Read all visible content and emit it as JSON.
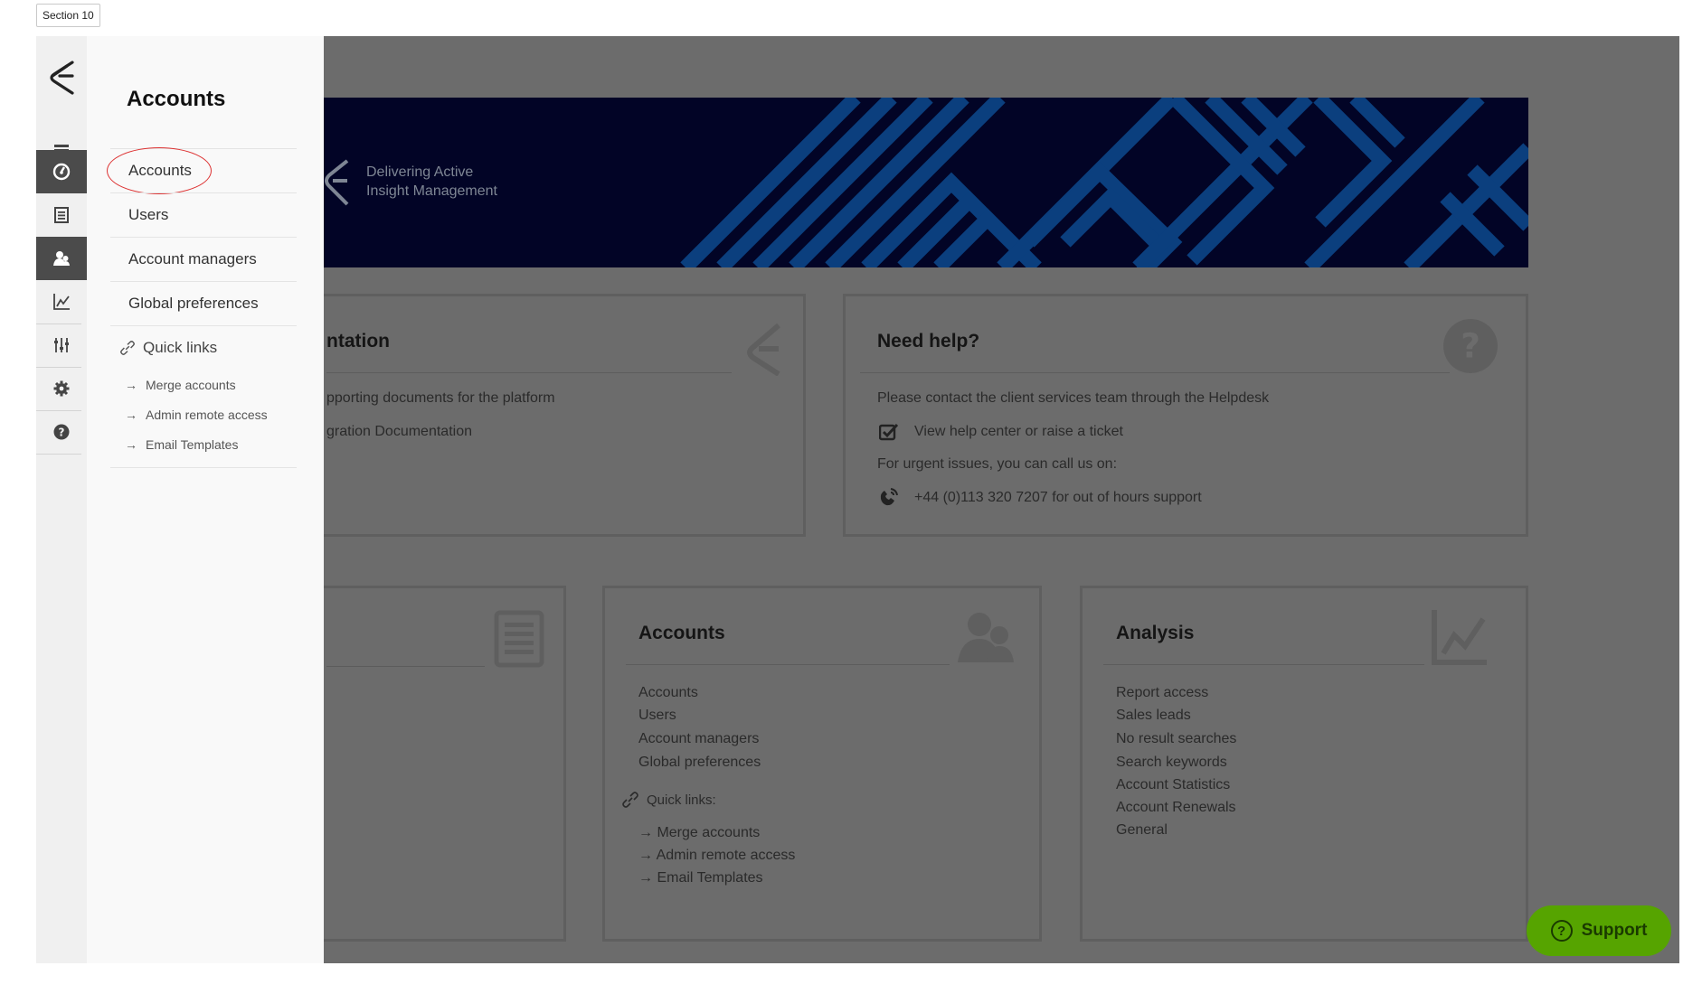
{
  "section_tag": "Section 10",
  "rail": {
    "items": [
      {
        "icon": "menu-icon"
      },
      {
        "icon": "dashboard-icon",
        "active": true
      },
      {
        "icon": "document-icon"
      },
      {
        "icon": "user-icon",
        "active": true
      },
      {
        "icon": "chart-icon"
      },
      {
        "icon": "sliders-icon"
      },
      {
        "icon": "gear-icon"
      },
      {
        "icon": "help-icon"
      }
    ]
  },
  "panel": {
    "title": "Accounts",
    "items": [
      "Accounts",
      "Users",
      "Account managers",
      "Global preferences"
    ],
    "quick_links_label": "Quick links",
    "quick_links": [
      "Merge accounts",
      "Admin remote access",
      "Email Templates"
    ]
  },
  "banner": {
    "line1": "Delivering Active",
    "line2": "Insight Management"
  },
  "documentation_card": {
    "title": "ntation",
    "line1": "pporting documents for the platform",
    "line2": "gration Documentation"
  },
  "help_card": {
    "title": "Need help?",
    "intro": "Please contact the client services team through the Helpdesk",
    "helpdesk_link": "View help center or raise a ticket",
    "urgent": "For urgent issues, you can call us on:",
    "phone": "+44 (0)113 320 7207 for out of hours support"
  },
  "accounts_card": {
    "title": "Accounts",
    "links": [
      "Accounts",
      "Users",
      "Account managers",
      "Global preferences"
    ],
    "quick_links_label": "Quick links:",
    "quick_links": [
      "Merge accounts",
      "Admin remote access",
      "Email Templates"
    ]
  },
  "analysis_card": {
    "title": "Analysis",
    "links": [
      "Report access",
      "Sales leads",
      "No result searches",
      "Search keywords",
      "Account Statistics",
      "Account Renewals",
      "General"
    ]
  },
  "support_button": {
    "label": "Support"
  },
  "colors": {
    "accent_green": "#56a400",
    "banner_navy": "#020426",
    "stripe_blue": "#0b3f7e",
    "highlight_red": "#dd3333"
  }
}
